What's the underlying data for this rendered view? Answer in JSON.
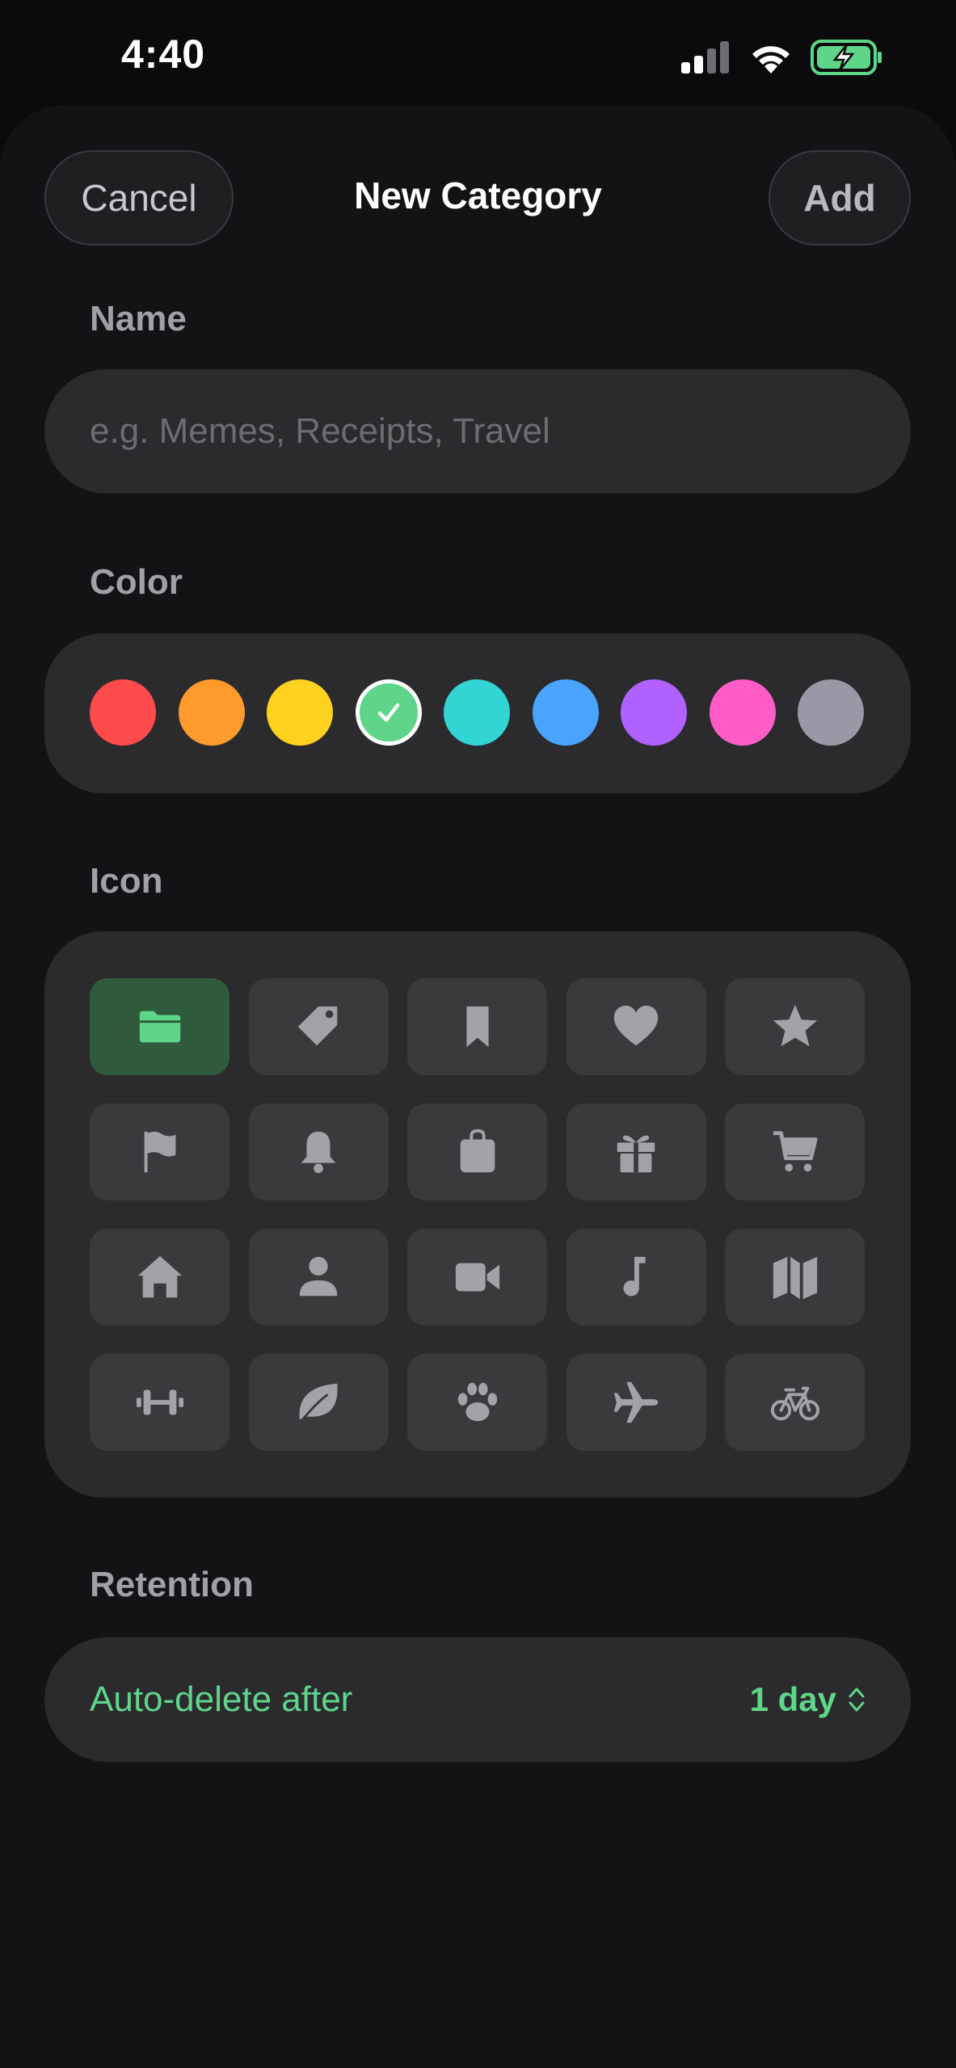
{
  "status_bar": {
    "time": "4:40",
    "icons": [
      "signal-icon",
      "wifi-icon",
      "battery-charging-icon"
    ]
  },
  "header": {
    "cancel_label": "Cancel",
    "title": "New Category",
    "add_label": "Add"
  },
  "name_section": {
    "label": "Name",
    "value": "",
    "placeholder": "e.g. Memes, Receipts, Travel"
  },
  "color_section": {
    "label": "Color",
    "selected": 3,
    "swatches": [
      "#ff4b4b",
      "#ff9a2c",
      "#ffd21f",
      "#5fd58a",
      "#32d4d4",
      "#4aa3ff",
      "#b061ff",
      "#ff5cc6",
      "#9898a6"
    ]
  },
  "icon_section": {
    "label": "Icon",
    "selected": 0,
    "icons": [
      "folder-icon",
      "tag-icon",
      "bookmark-icon",
      "heart-icon",
      "star-icon",
      "flag-icon",
      "bell-icon",
      "bag-icon",
      "gift-icon",
      "cart-icon",
      "house-icon",
      "person-icon",
      "video-icon",
      "music-note-icon",
      "map-icon",
      "dumbbell-icon",
      "leaf-icon",
      "paw-icon",
      "airplane-icon",
      "bicycle-icon"
    ]
  },
  "retention_section": {
    "label": "Retention",
    "row_label": "Auto-delete after",
    "value": "1 day"
  },
  "colors": {
    "accent": "#5fd58a",
    "background": "#0b0b0d",
    "card": "#2b2b2e"
  }
}
